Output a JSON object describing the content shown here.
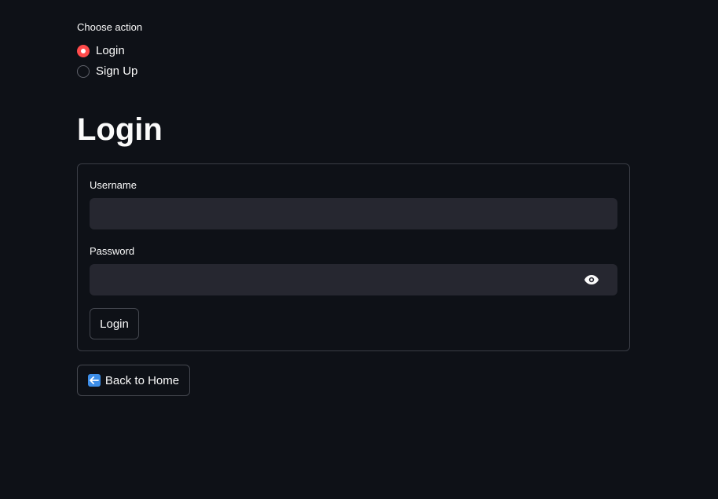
{
  "action_selector": {
    "label": "Choose action",
    "options": [
      {
        "label": "Login",
        "selected": true
      },
      {
        "label": "Sign Up",
        "selected": false
      }
    ]
  },
  "heading": "Login",
  "form": {
    "username_label": "Username",
    "username_value": "",
    "password_label": "Password",
    "password_value": "",
    "submit_label": "Login"
  },
  "back_button": {
    "label": "Back to Home",
    "icon": "left-arrow-icon"
  },
  "colors": {
    "background": "#0e1117",
    "accent": "#ff4b4b",
    "input_bg": "#262730",
    "back_icon": "#3d8ee8"
  }
}
